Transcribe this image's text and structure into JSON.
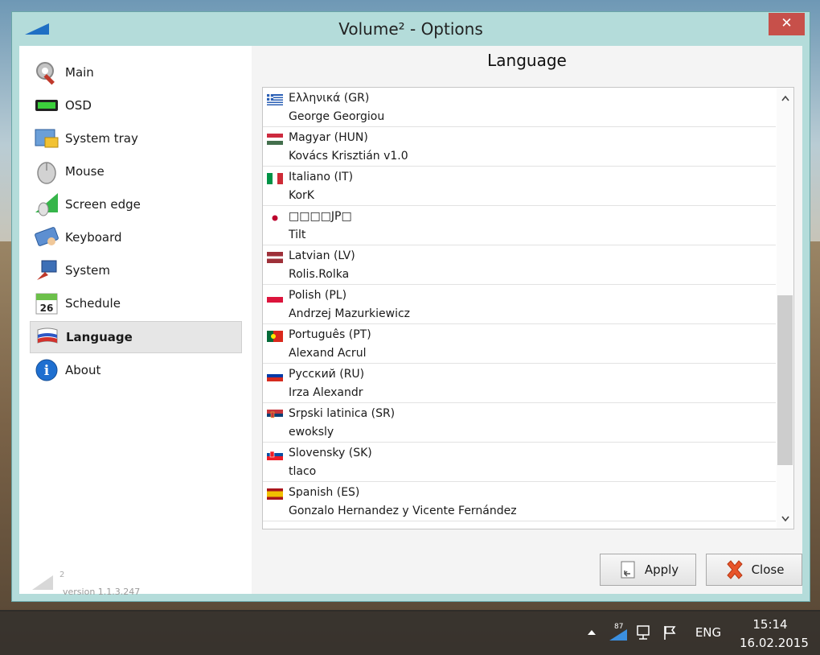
{
  "window": {
    "title": "Volume² - Options",
    "close_glyph": "✕"
  },
  "sidebar": {
    "items": [
      {
        "label": "Main",
        "icon": "wrench-gear-icon"
      },
      {
        "label": "OSD",
        "icon": "osd-bar-icon"
      },
      {
        "label": "System tray",
        "icon": "system-tray-icon"
      },
      {
        "label": "Mouse",
        "icon": "mouse-icon"
      },
      {
        "label": "Screen edge",
        "icon": "screen-edge-icon"
      },
      {
        "label": "Keyboard",
        "icon": "keyboard-icon"
      },
      {
        "label": "System",
        "icon": "system-icon"
      },
      {
        "label": "Schedule",
        "icon": "calendar-icon",
        "icon_text": "26"
      },
      {
        "label": "Language",
        "icon": "language-flag-icon",
        "selected": true
      },
      {
        "label": "About",
        "icon": "info-icon",
        "icon_text": "i"
      }
    ],
    "logo_superscript": "2",
    "version": "version 1.1.3.247"
  },
  "main": {
    "title": "Language",
    "languages": [
      {
        "name": "Ελληνικά (GR)",
        "author": "George Georgiou",
        "flag": "greece-flag-icon"
      },
      {
        "name": "Magyar (HUN)",
        "author": "Kovács Krisztián v1.0",
        "flag": "hungary-flag-icon"
      },
      {
        "name": "Italiano (IT)",
        "author": "KorK",
        "flag": "italy-flag-icon"
      },
      {
        "name": "□□□□JP□",
        "author": "Tilt",
        "flag": "japan-flag-icon"
      },
      {
        "name": "Latvian (LV)",
        "author": "Rolis.Rolka",
        "flag": "latvia-flag-icon"
      },
      {
        "name": "Polish (PL)",
        "author": "Andrzej Mazurkiewicz",
        "flag": "poland-flag-icon"
      },
      {
        "name": "Português (PT)",
        "author": "Alexand Acrul",
        "flag": "portugal-flag-icon"
      },
      {
        "name": "Русский (RU)",
        "author": "Irza Alexandr",
        "flag": "russia-flag-icon"
      },
      {
        "name": "Srpski latinica (SR)",
        "author": "ewoksly",
        "flag": "serbia-flag-icon"
      },
      {
        "name": "Slovensky (SK)",
        "author": "tlaco",
        "flag": "slovakia-flag-icon"
      },
      {
        "name": "Spanish (ES)",
        "author": "Gonzalo Hernandez y Vicente Fernández",
        "flag": "spain-flag-icon"
      }
    ],
    "scroll_up_glyph": "ⱏ",
    "scroll_down_glyph": "ⱅ"
  },
  "buttons": {
    "apply": "Apply",
    "close": "Close"
  },
  "taskbar": {
    "tray_volume_level": "87",
    "language": "ENG",
    "time": "15:14",
    "date": "16.02.2015"
  },
  "colors": {
    "window_frame": "#b4dcda",
    "title_close": "#c7504a",
    "selected_item": "#e6e6e6",
    "scroll_thumb": "#cdcdcd"
  }
}
